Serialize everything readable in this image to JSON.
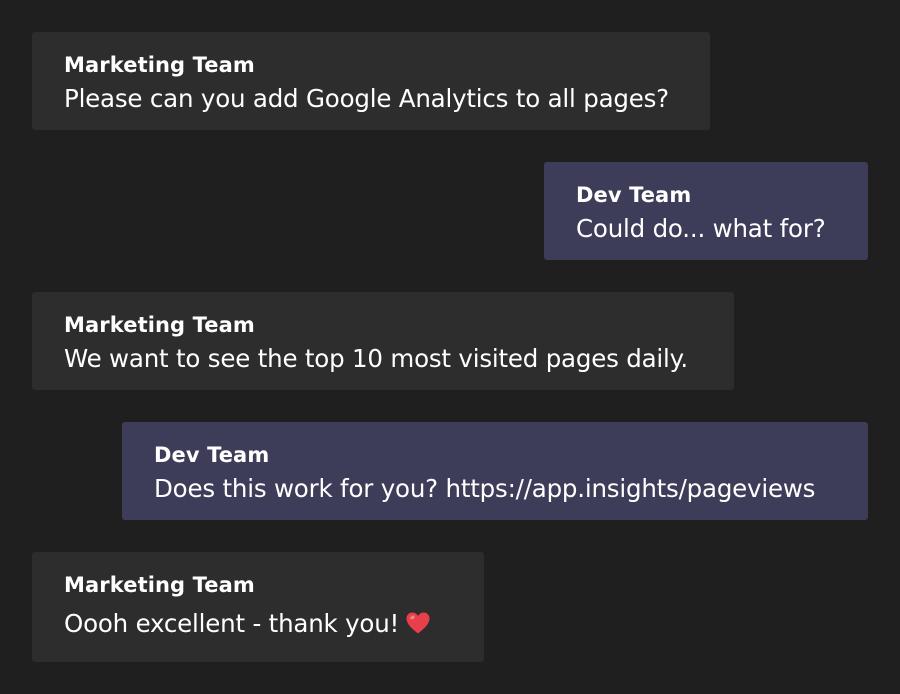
{
  "messages": [
    {
      "sender": "Marketing Team",
      "text": "Please can you add Google Analytics to all pages?"
    },
    {
      "sender": "Dev Team",
      "text": "Could do... what for?"
    },
    {
      "sender": "Marketing Team",
      "text": "We want to see the top 10 most visited pages daily."
    },
    {
      "sender": "Dev Team",
      "text": "Does this work for you? https://app.insights/pageviews"
    },
    {
      "sender": "Marketing Team",
      "text": "Oooh excellent - thank you!",
      "emoji": "heart-emoji"
    }
  ],
  "colors": {
    "background": "#1f1f1f",
    "incoming_bubble": "#2d2d2d",
    "outgoing_bubble": "#3d3d59",
    "text": "#ffffff",
    "heart": "#e8404a"
  }
}
